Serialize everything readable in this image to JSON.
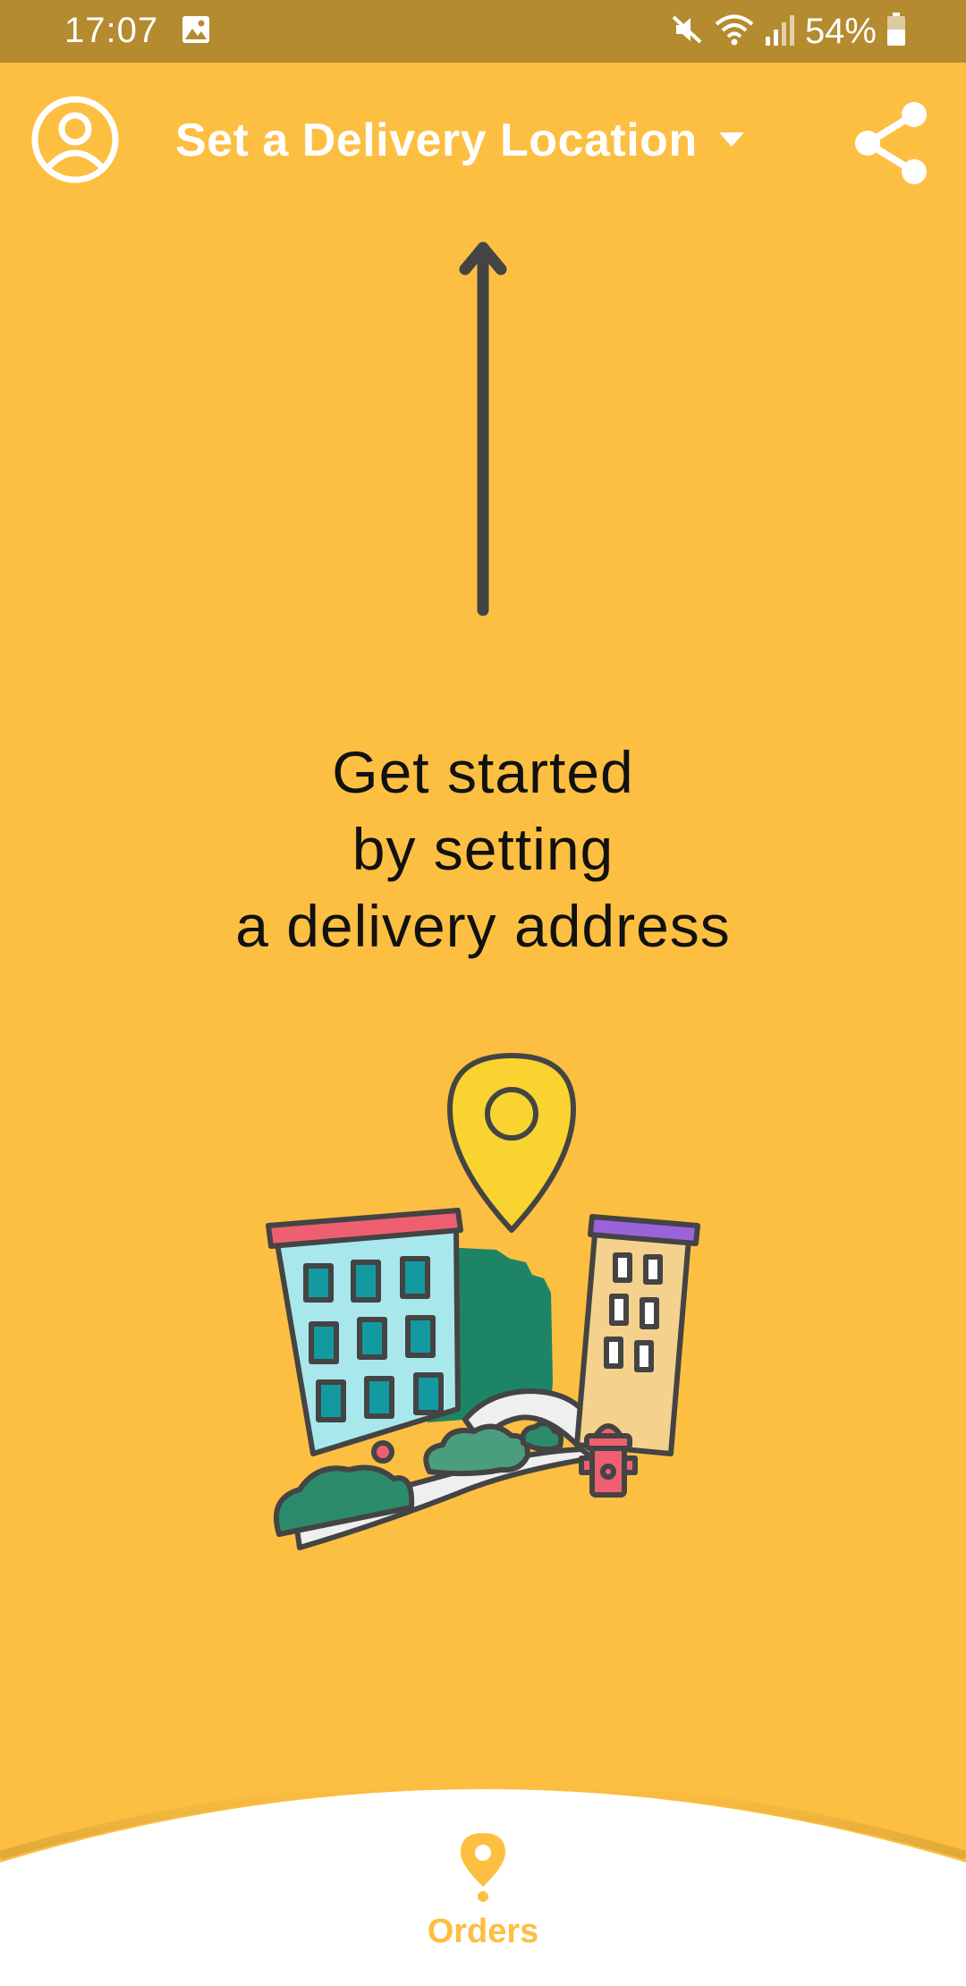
{
  "status_bar": {
    "time": "17:07",
    "battery_percent": "54%",
    "icons": [
      "image-icon",
      "mute-icon",
      "wifi-icon",
      "signal-icon",
      "battery-icon"
    ]
  },
  "header": {
    "location_label": "Set a Delivery Location",
    "profile_icon": "profile-icon",
    "share_icon": "share-icon"
  },
  "main": {
    "headline_lines": [
      "Get started",
      "by setting",
      "a delivery address"
    ]
  },
  "bottom_nav": {
    "orders_label": "Orders"
  },
  "colors": {
    "background": "#FDBF41",
    "status_bar": "#B48B2F",
    "accent": "#FDBF41",
    "arrow": "#444444"
  }
}
